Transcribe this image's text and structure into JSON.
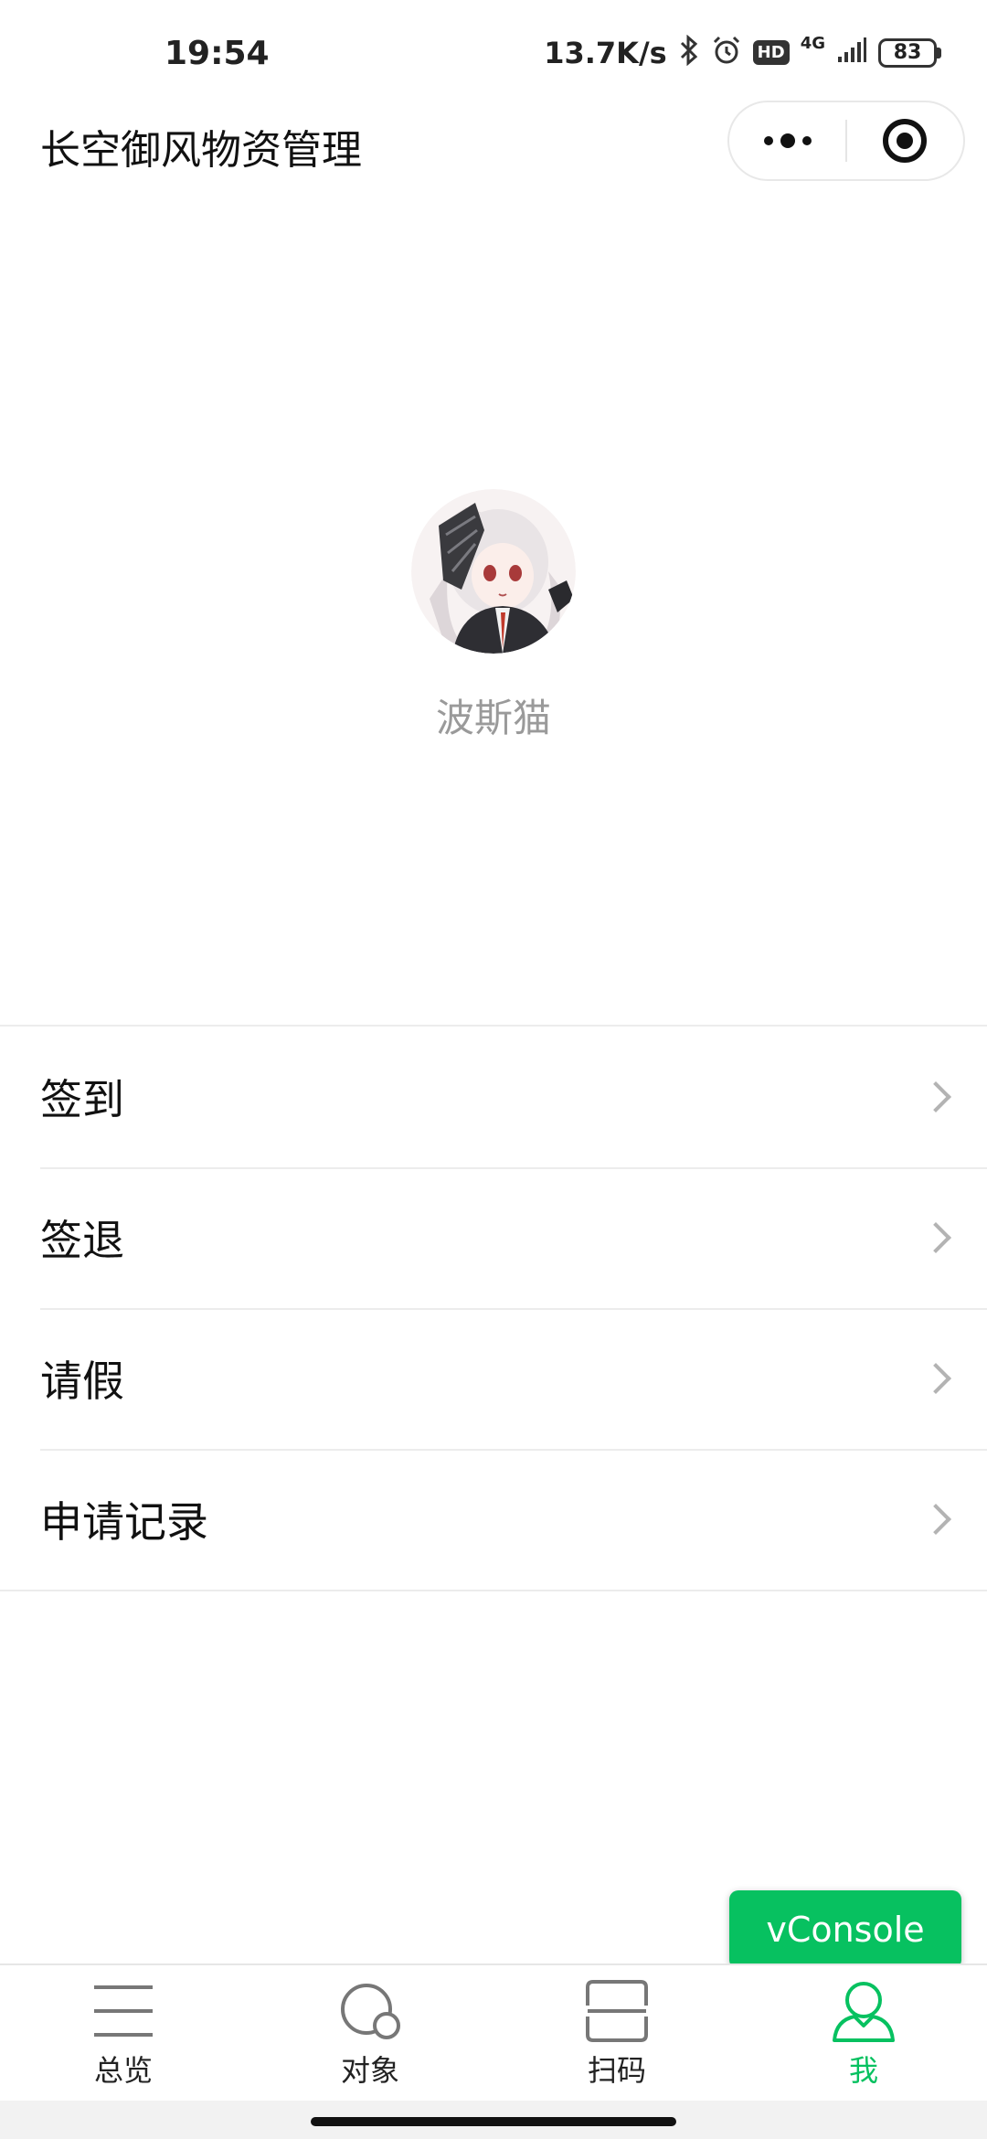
{
  "status_bar": {
    "time": "19:54",
    "network_speed": "13.7K/s",
    "hd_label": "HD",
    "network_type": "4G",
    "battery": "83",
    "icons": [
      "bluetooth-icon",
      "alarm-icon",
      "signal-icon"
    ]
  },
  "header": {
    "title": "长空御风物资管理",
    "capsule": {
      "more_icon": "more-dots-icon",
      "close_icon": "target-icon"
    }
  },
  "profile": {
    "username": "波斯猫"
  },
  "menu": {
    "items": [
      {
        "label": "签到"
      },
      {
        "label": "签退"
      },
      {
        "label": "请假"
      },
      {
        "label": "申请记录"
      }
    ]
  },
  "vconsole": {
    "label": "vConsole"
  },
  "tabbar": {
    "active_color": "#07c160",
    "items": [
      {
        "label": "总览",
        "icon": "menu-lines-icon"
      },
      {
        "label": "对象",
        "icon": "objects-circle-icon"
      },
      {
        "label": "扫码",
        "icon": "scan-icon"
      },
      {
        "label": "我",
        "icon": "person-icon"
      }
    ]
  }
}
